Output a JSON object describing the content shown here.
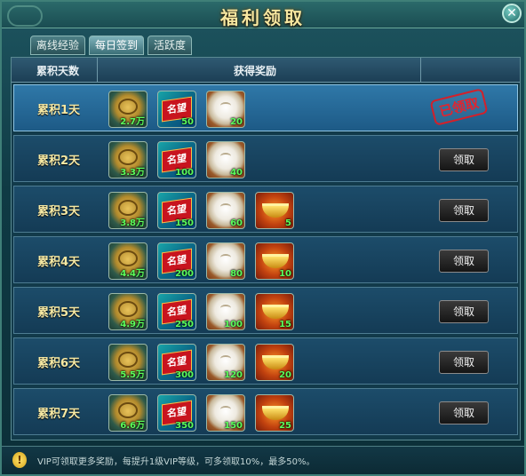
{
  "window": {
    "title": "福利领取",
    "close_label": "✕"
  },
  "tabs": [
    {
      "label": "离线经验",
      "active": false
    },
    {
      "label": "每日签到",
      "active": true
    },
    {
      "label": "活跃度",
      "active": false
    }
  ],
  "table": {
    "col_days": "累积天数",
    "col_rewards": "获得奖励",
    "claim_label": "领取",
    "claimed_stamp": "已领取"
  },
  "rows": [
    {
      "label": "累积1天",
      "claimed": true,
      "items": [
        {
          "type": "coin",
          "qty": "2.7万"
        },
        {
          "type": "fame",
          "qty": "50"
        },
        {
          "type": "bun",
          "qty": "20"
        }
      ]
    },
    {
      "label": "累积2天",
      "claimed": false,
      "items": [
        {
          "type": "coin",
          "qty": "3.3万"
        },
        {
          "type": "fame",
          "qty": "100"
        },
        {
          "type": "bun",
          "qty": "40"
        }
      ]
    },
    {
      "label": "累积3天",
      "claimed": false,
      "items": [
        {
          "type": "coin",
          "qty": "3.8万"
        },
        {
          "type": "fame",
          "qty": "150"
        },
        {
          "type": "bun",
          "qty": "60"
        },
        {
          "type": "ingot",
          "qty": "5"
        }
      ]
    },
    {
      "label": "累积4天",
      "claimed": false,
      "items": [
        {
          "type": "coin",
          "qty": "4.4万"
        },
        {
          "type": "fame",
          "qty": "200"
        },
        {
          "type": "bun",
          "qty": "80"
        },
        {
          "type": "ingot",
          "qty": "10"
        }
      ]
    },
    {
      "label": "累积5天",
      "claimed": false,
      "items": [
        {
          "type": "coin",
          "qty": "4.9万"
        },
        {
          "type": "fame",
          "qty": "250"
        },
        {
          "type": "bun",
          "qty": "100"
        },
        {
          "type": "ingot",
          "qty": "15"
        }
      ]
    },
    {
      "label": "累积6天",
      "claimed": false,
      "items": [
        {
          "type": "coin",
          "qty": "5.5万"
        },
        {
          "type": "fame",
          "qty": "300"
        },
        {
          "type": "bun",
          "qty": "120"
        },
        {
          "type": "ingot",
          "qty": "20"
        }
      ]
    },
    {
      "label": "累积7天",
      "claimed": false,
      "items": [
        {
          "type": "coin",
          "qty": "6.6万"
        },
        {
          "type": "fame",
          "qty": "350"
        },
        {
          "type": "bun",
          "qty": "150"
        },
        {
          "type": "ingot",
          "qty": "25"
        }
      ]
    }
  ],
  "item_glyphs": {
    "coin": "coin-icon",
    "fame": "fame-icon",
    "bun": "bun-icon",
    "ingot": "ingot-icon",
    "fame_text": "名望"
  },
  "footer": {
    "tip": "VIP可领取更多奖励，每提升1级VIP等级，可多领取10%，最多50%。",
    "tip_icon": "!"
  }
}
